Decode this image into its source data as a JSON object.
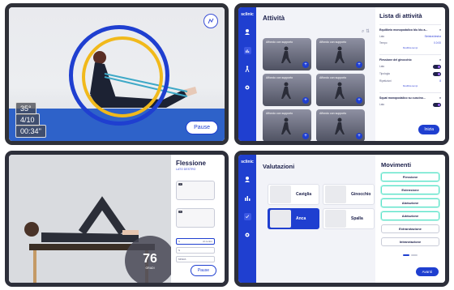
{
  "panel1": {
    "stats": [
      "35°",
      "4/10",
      "00:34''"
    ],
    "pause_label": "Pause"
  },
  "panel2": {
    "logo": "sclinic",
    "title": "Attività",
    "sidebar": [
      "",
      "",
      "",
      ""
    ],
    "card_title": "Affondo con supporto",
    "list": {
      "title": "Lista di attività",
      "sections": [
        {
          "head": "Equilibrio monopodalico blu blu a...",
          "rows": [
            [
              "Lato",
              "Sinistra/destra"
            ],
            [
              "Tempo",
              "0.0:00"
            ]
          ],
          "link": "Modifica tempi"
        },
        {
          "head": "Flessione del ginocchio",
          "rows": [
            [
              "Lato",
              ""
            ],
            [
              "Tipologia",
              ""
            ],
            [
              "Ripetizioni",
              "8"
            ]
          ],
          "link": "Modifica tempi"
        },
        {
          "head": "Squat monopodalico su cuscino...",
          "rows": [
            [
              "Lato",
              ""
            ]
          ],
          "link": ""
        }
      ],
      "start_label": "Inizia"
    }
  },
  "panel3": {
    "title": "Flessione",
    "subtitle": "LATO DESTRO",
    "fields": [
      [
        "S",
        "Al centro"
      ],
      [
        "S",
        ""
      ],
      [
        "MISRA",
        ""
      ]
    ],
    "gauge_value": "76",
    "gauge_unit": "GRADI",
    "pause_label": "Pause"
  },
  "panel4": {
    "logo": "sclinic",
    "title": "Valutazioni",
    "tiles": [
      "Caviglia",
      "Ginocchio",
      "Anca",
      "Spalla"
    ],
    "selected_tile": "Anca",
    "movements_title": "Movimenti",
    "movements": [
      "Flessione",
      "Estensione",
      "Abduzione",
      "Adduzione",
      "Extrarotazione",
      "Intrarotazione"
    ],
    "next_label": "Avanti"
  },
  "colors": {
    "brand": "#1f3fd0",
    "accent_yellow": "#f1b91b",
    "accent_teal": "#59e3c9"
  }
}
